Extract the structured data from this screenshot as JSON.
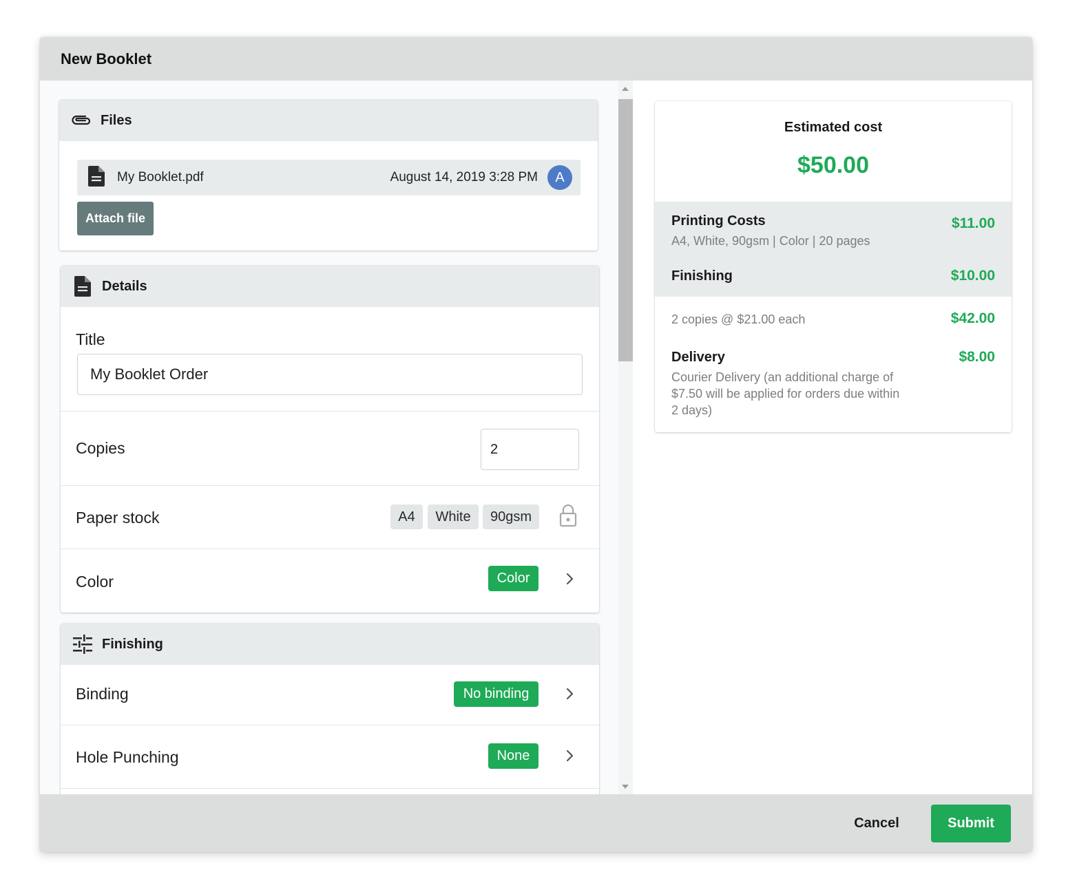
{
  "dialog": {
    "title": "New Booklet"
  },
  "files": {
    "heading": "Files",
    "file": {
      "name": "My Booklet.pdf",
      "date": "August 14, 2019 3:28 PM",
      "avatar_initial": "A"
    },
    "attach_label": "Attach file"
  },
  "details": {
    "heading": "Details",
    "title_label": "Title",
    "title_value": "My Booklet Order",
    "copies_label": "Copies",
    "copies_value": "2",
    "paper_label": "Paper stock",
    "paper_chips": [
      "A4",
      "White",
      "90gsm"
    ],
    "color_label": "Color",
    "color_value": "Color"
  },
  "finishing": {
    "heading": "Finishing",
    "binding_label": "Binding",
    "binding_value": "No binding",
    "hole_label": "Hole Punching",
    "hole_value": "None"
  },
  "estimate": {
    "label": "Estimated cost",
    "total": "$50.00",
    "printing": {
      "name": "Printing Costs",
      "desc": "A4, White, 90gsm | Color | 20 pages",
      "amount": "$11.00"
    },
    "finishing": {
      "name": "Finishing",
      "amount": "$10.00"
    },
    "copies": {
      "desc": "2 copies @ $21.00 each",
      "amount": "$42.00"
    },
    "delivery": {
      "name": "Delivery",
      "desc_lines": [
        "Courier Delivery (an additional charge of",
        "$7.50 will be applied for orders due within",
        "2 days)"
      ],
      "amount": "$8.00"
    }
  },
  "footer": {
    "cancel_label": "Cancel",
    "submit_label": "Submit"
  },
  "colors": {
    "accent_green": "#1faa57",
    "avatar_blue": "#4d7bc7",
    "attach_btn": "#657b7c",
    "header_grey": "#dcdedd"
  }
}
